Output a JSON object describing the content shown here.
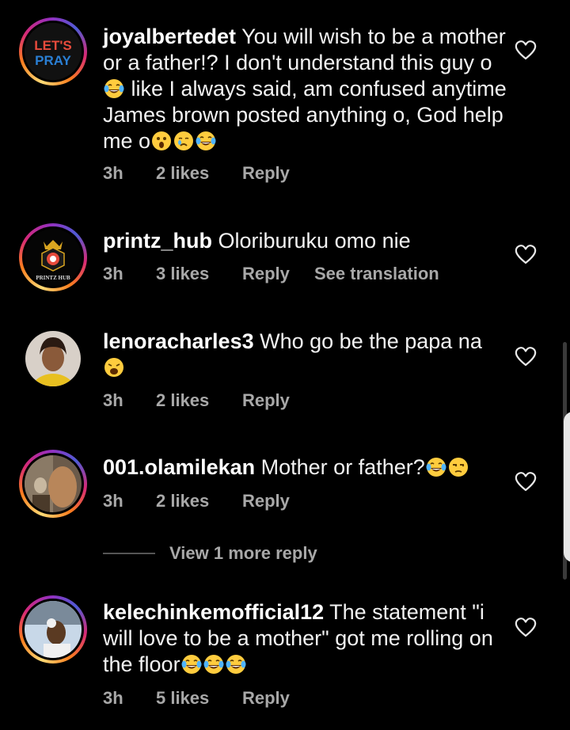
{
  "comments": [
    {
      "username": "joyalbertedet",
      "text_1": "You will wish to be a mother or a father!? I don't understand this guy o",
      "text_2": " like I always said, am confused anytime James brown posted anything o, God help me o",
      "time": "3h",
      "likes": "2 likes",
      "reply": "Reply",
      "avatar_logo_line1": "LET'S",
      "avatar_logo_line2": "PRAY",
      "emoji_1": "laughing-tears",
      "emoji_trailing": [
        "surprised",
        "crying",
        "laughing-tears"
      ]
    },
    {
      "username": "printz_hub",
      "text": "Oloriburuku omo nie",
      "time": "3h",
      "likes": "3 likes",
      "reply": "Reply",
      "translate": "See translation",
      "avatar_logo_text": "PRINTZ HUB"
    },
    {
      "username": "lenoracharles3",
      "text": "Who go be the papa na",
      "time": "3h",
      "likes": "2 likes",
      "reply": "Reply",
      "emoji_trailing": [
        "weary"
      ]
    },
    {
      "username": "001.olamilekan",
      "text": "Mother or father?",
      "time": "3h",
      "likes": "2 likes",
      "reply": "Reply",
      "emoji_trailing": [
        "laughing-tears",
        "unamused"
      ]
    },
    {
      "username": "kelechinkemofficial12",
      "text": "The statement \"i will love to be a mother\" got me rolling on the floor",
      "time": "3h",
      "likes": "5 likes",
      "reply": "Reply",
      "emoji_trailing": [
        "laughing-tears",
        "laughing-tears",
        "laughing-tears"
      ]
    }
  ],
  "view_more_replies": "View 1 more reply",
  "colors": {
    "background": "#000000",
    "text": "#f2f2f2",
    "meta": "#a8a8a8",
    "story_ring": [
      "#feda75",
      "#fa7e1e",
      "#d62976",
      "#962fbf",
      "#4f5bd5"
    ]
  }
}
